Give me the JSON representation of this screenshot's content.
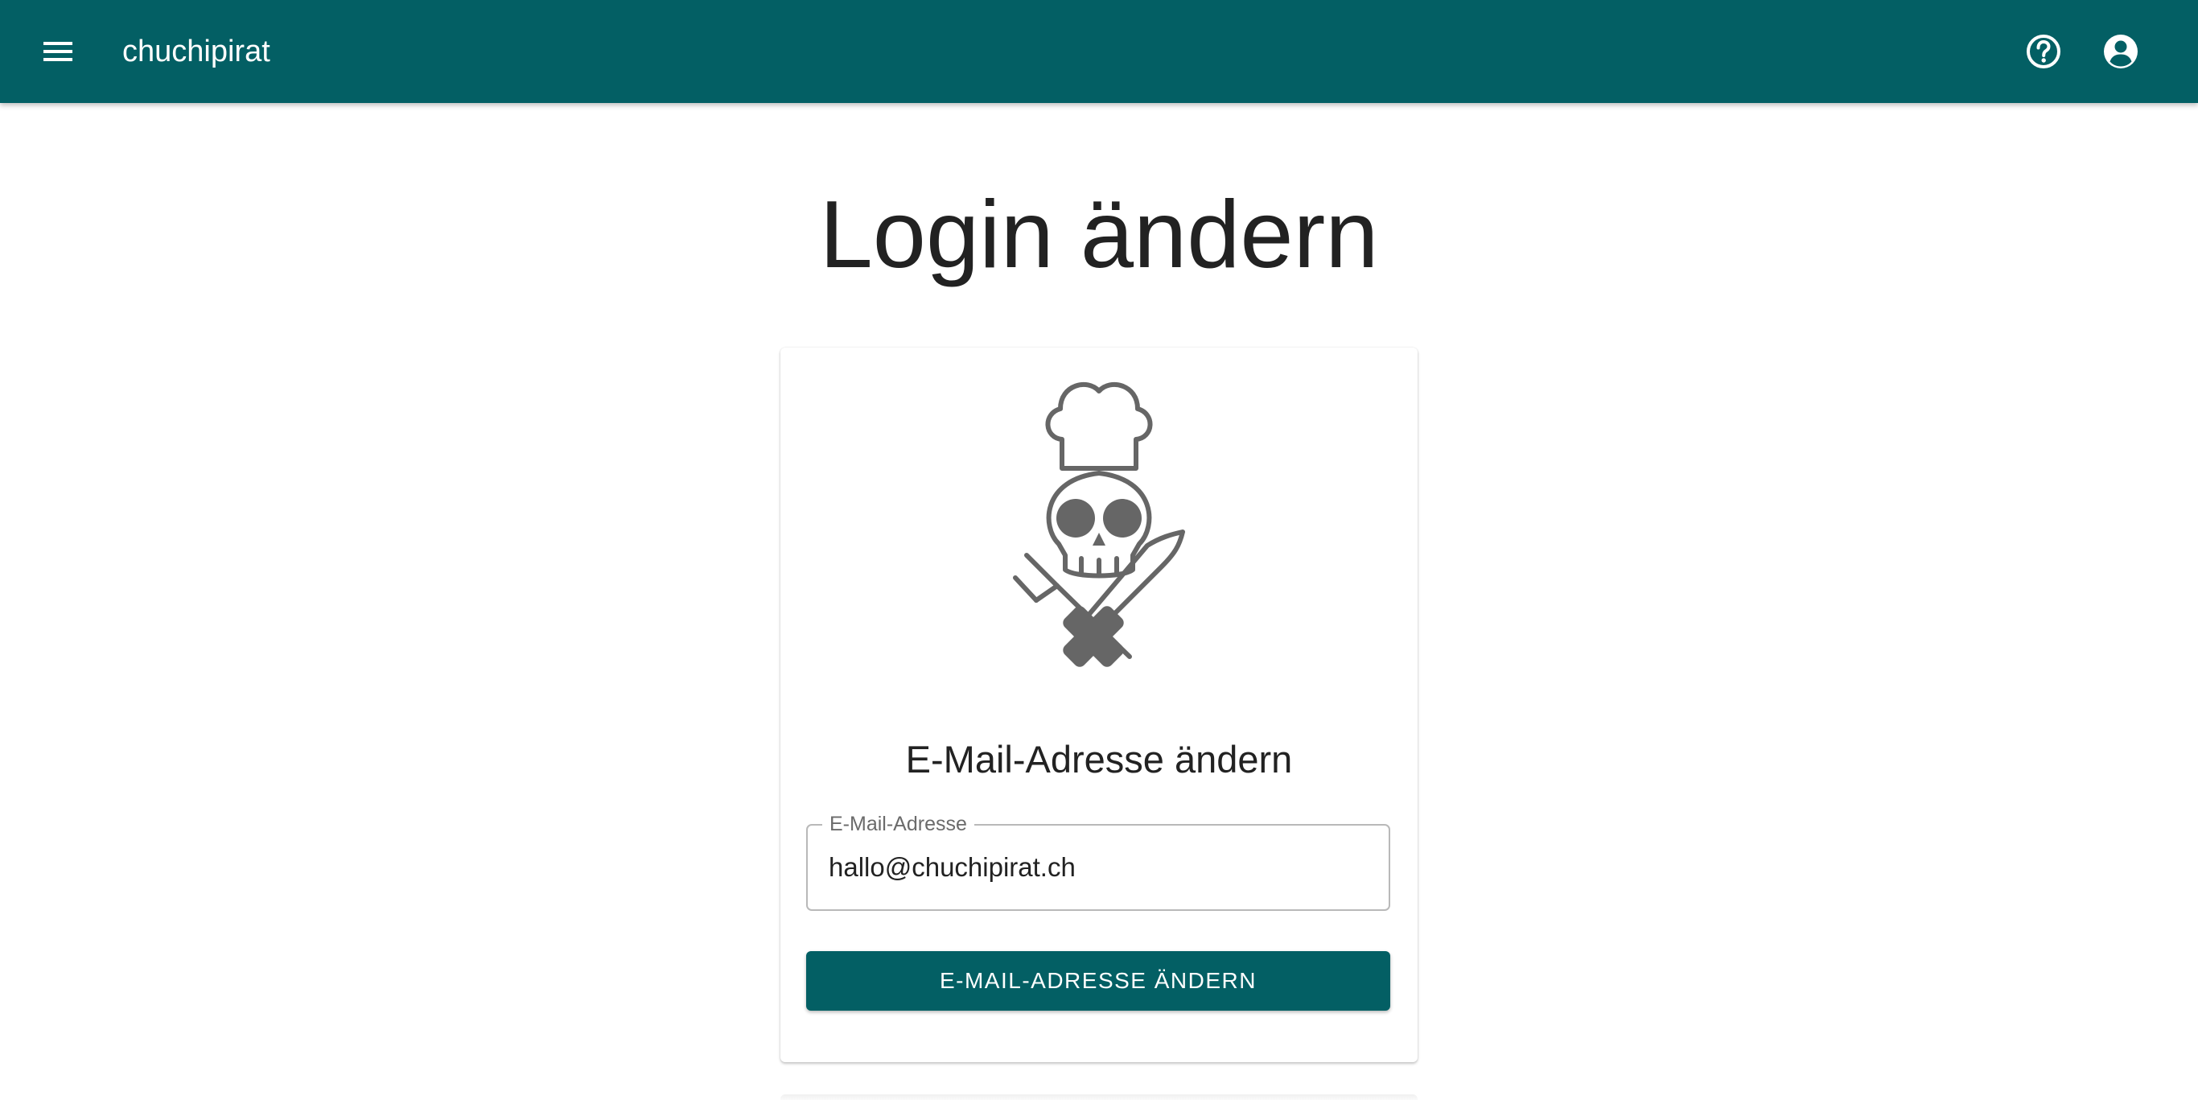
{
  "theme": {
    "primary": "#035f64",
    "logo_gray": "#666666"
  },
  "appbar": {
    "menu_icon": "menu-icon",
    "title": "chuchipirat",
    "help_icon": "help-circle-icon",
    "account_icon": "account-circle-icon"
  },
  "main": {
    "title": "Login ändern"
  },
  "card": {
    "logo": "chuchipirat-skull-chef-logo",
    "heading": "E-Mail-Adresse ändern",
    "email_field": {
      "label": "E-Mail-Adresse",
      "value": "hallo@chuchipirat.ch"
    },
    "submit_label": "E-MAIL-ADRESSE ÄNDERN"
  }
}
